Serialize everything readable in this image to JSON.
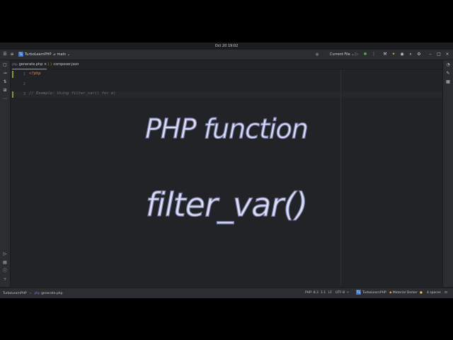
{
  "system": {
    "clock": "Oct 20  19:02"
  },
  "titlebar": {
    "project_badge": "TL",
    "project_name": "TurboLearnPHP",
    "branch": "main",
    "run_config": "Current File"
  },
  "tabs": [
    {
      "label": "generate.php",
      "type": "php"
    },
    {
      "label": "composer.json",
      "type": "json"
    }
  ],
  "editor": {
    "lines": [
      {
        "number": "1",
        "text": "<?php"
      },
      {
        "number": "2",
        "text": ""
      },
      {
        "number": "3",
        "text": "// Example: Using filter_var() for e|"
      }
    ]
  },
  "overlay": {
    "line1": "PHP function",
    "line2": "filter_var()"
  },
  "statusbar": {
    "breadcrumb_project": "TurboLearnPHP",
    "breadcrumb_file": "generate.php",
    "php_version": "PHP: 8.3",
    "position": "1:1",
    "line_sep": "LF",
    "encoding": "UTF-8",
    "project_badge": "TL",
    "project": "TurboLearnPHP",
    "theme": "Material Darker",
    "indent": "4 spaces"
  },
  "colors": {
    "accent": "#e08855",
    "project_badge": "#3d77d1",
    "gutter_change": "#7a9a3a"
  }
}
